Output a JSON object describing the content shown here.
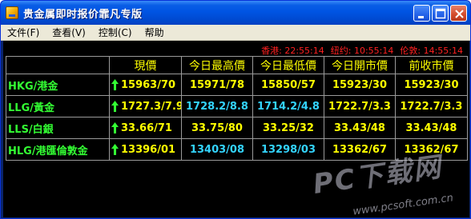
{
  "window": {
    "title": "贵金属即时报价霏凡专版"
  },
  "menu": [
    {
      "label": "文件(F)"
    },
    {
      "label": "查看(V)"
    },
    {
      "label": "控制(C)"
    },
    {
      "label": "帮助"
    }
  ],
  "clocks": [
    {
      "label": "香港:",
      "time": "22:55:14"
    },
    {
      "label": "纽约:",
      "time": "10:55:14"
    },
    {
      "label": "伦敦:",
      "time": "14:55:14"
    }
  ],
  "table": {
    "headers": [
      "現價",
      "今日最高價",
      "今日最低價",
      "今日開市價",
      "前收市價"
    ],
    "rows": [
      {
        "name": "HKG/港金",
        "current": "15963/70",
        "high": "15971/78",
        "low": "15850/57",
        "open": "15923/30",
        "prev_close": "15923/30",
        "trend": "up",
        "hi_lo_color": "yellow"
      },
      {
        "name": "LLG/黃金",
        "current": "1727.3/7.9",
        "high": "1728.2/8.8",
        "low": "1714.2/4.8",
        "open": "1722.7/3.3",
        "prev_close": "1722.7/3.3",
        "trend": "up",
        "hi_lo_color": "cyan"
      },
      {
        "name": "LLS/白銀",
        "current": "33.66/71",
        "high": "33.75/80",
        "low": "33.25/32",
        "open": "33.43/48",
        "prev_close": "33.43/48",
        "trend": "up",
        "hi_lo_color": "yellow"
      },
      {
        "name": "HLG/港匯倫敦金",
        "current": "13396/01",
        "high": "13403/08",
        "low": "13298/03",
        "open": "13362/67",
        "prev_close": "13362/67",
        "trend": "up",
        "hi_lo_color": "cyan"
      }
    ]
  },
  "colors": {
    "name": "#33ff33",
    "price_yellow": "#ffff00",
    "price_cyan": "#33d4ff",
    "arrow_up": "#33ff33",
    "clock": "#ff2020"
  },
  "watermark": {
    "logo": "PC下载网",
    "url": "www.pcsoft.com.cn"
  }
}
